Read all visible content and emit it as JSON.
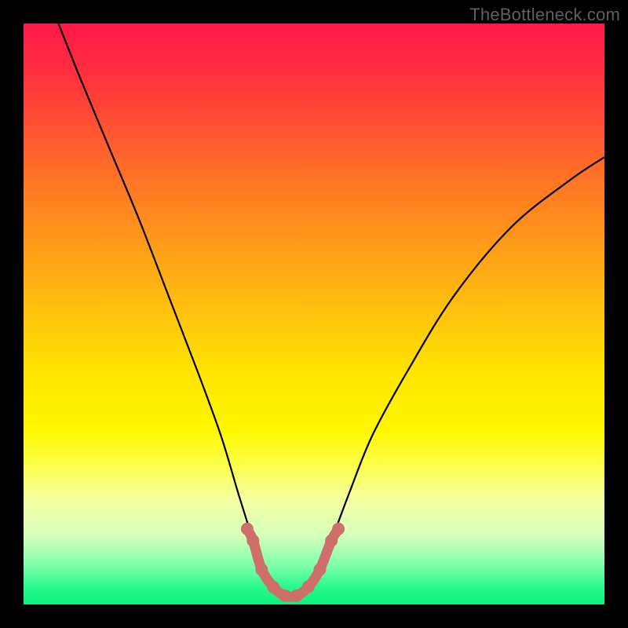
{
  "watermark": {
    "text": "TheBottleneck.com"
  },
  "colors": {
    "frame": "#000000",
    "curve": "#000000",
    "valley": "#cf6f6c",
    "bg_gradient": "linear-gradient(to bottom, #ff1849 0%, #ff2e3f 8%, #ff5a2e 20%, #ff8a1f 33%, #ffb611 46%, #ffe400 60%, #fff700 70%, #fcff4a 76%, #f4ffa1 82%, #d6ffba 88%, #84ffac 93%, #29f98c 97%, #0cf07f 100%)"
  },
  "chart_data": {
    "type": "line",
    "title": "",
    "xlabel": "",
    "ylabel": "",
    "xlim": [
      0,
      100
    ],
    "ylim": [
      0,
      100
    ],
    "series": [
      {
        "name": "bottleneck-curve",
        "x": [
          6,
          10,
          15,
          20,
          25,
          30,
          34,
          37,
          39.5,
          41,
          43,
          45,
          47,
          49,
          51,
          53,
          56,
          60,
          66,
          74,
          84,
          94,
          100
        ],
        "y": [
          100,
          90,
          78,
          66,
          53,
          40,
          29,
          19,
          11,
          6,
          3,
          1.5,
          1.5,
          3,
          6,
          11,
          19,
          29,
          40,
          53,
          65,
          73,
          77
        ]
      }
    ],
    "valley_highlight": {
      "name": "valley-marker",
      "x": [
        38.5,
        39.5,
        41,
        43,
        45,
        47,
        49,
        51,
        53,
        54.2
      ],
      "y": [
        13,
        11,
        6,
        3,
        1.5,
        1.5,
        3,
        6,
        11,
        13
      ]
    }
  }
}
